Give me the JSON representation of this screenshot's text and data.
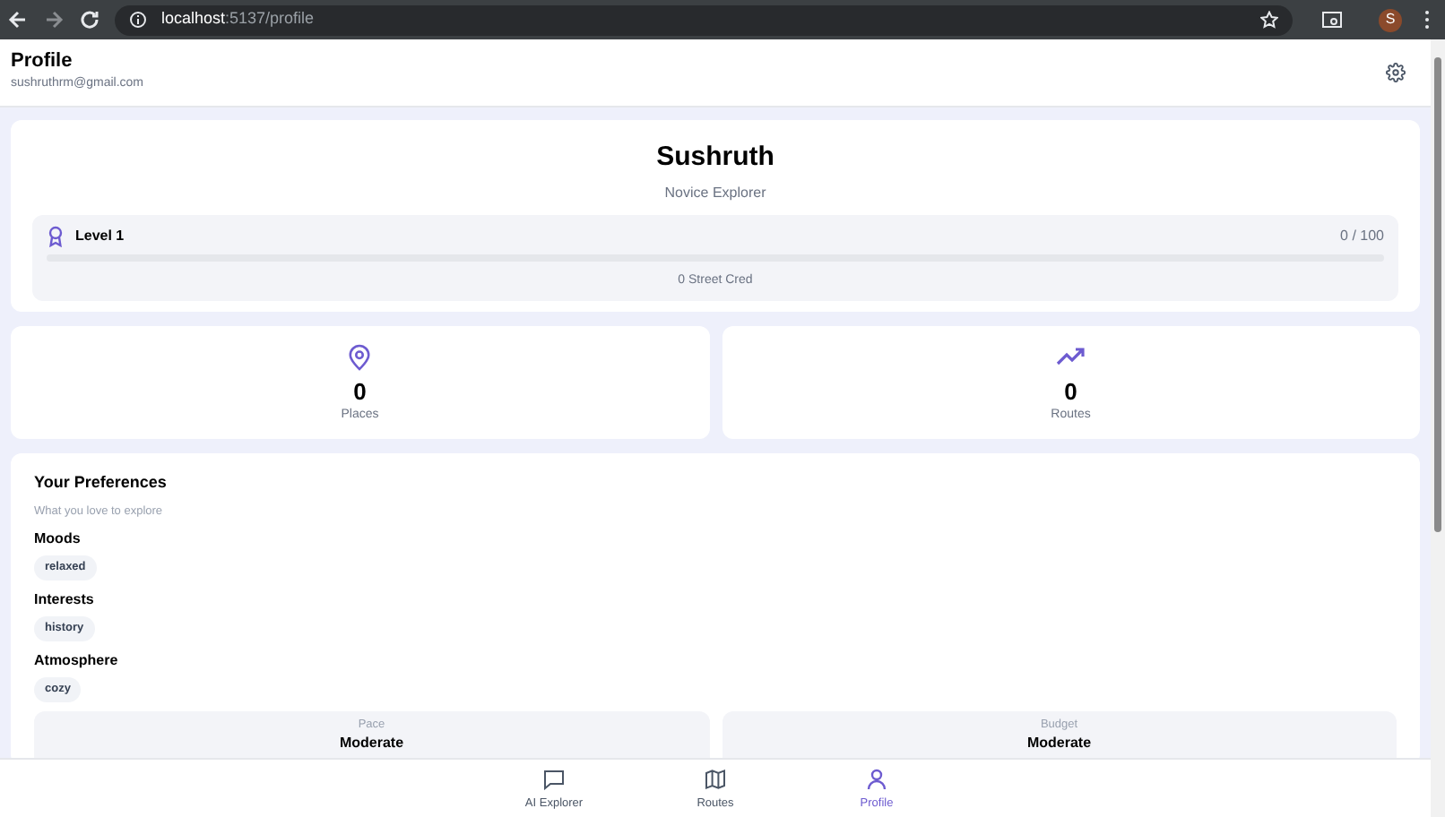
{
  "browser": {
    "url_host": "localhost",
    "url_rest": ":5137/profile",
    "avatar": "S"
  },
  "header": {
    "title": "Profile",
    "email": "sushruthrm@gmail.com"
  },
  "profile": {
    "name": "Sushruth",
    "rank": "Novice Explorer",
    "level_label": "Level 1",
    "progress_text": "0 / 100",
    "level": 0,
    "cred": "0 Street Cred"
  },
  "stats": [
    {
      "kind": "pin",
      "value": "0",
      "label": "Places"
    },
    {
      "kind": "trend",
      "value": "0",
      "label": "Routes"
    }
  ],
  "preferences": {
    "title": "Your Preferences",
    "subtitle": "What you love to explore",
    "groups": [
      {
        "title": "Moods",
        "tags": [
          "relaxed"
        ]
      },
      {
        "title": "Interests",
        "tags": [
          "history"
        ]
      },
      {
        "title": "Atmosphere",
        "tags": [
          "cozy"
        ]
      }
    ],
    "settings": [
      {
        "label": "Pace",
        "value": "Moderate"
      },
      {
        "label": "Budget",
        "value": "Moderate"
      }
    ]
  },
  "nav": [
    {
      "kind": "chat",
      "label": "AI Explorer",
      "selected": false
    },
    {
      "kind": "map",
      "label": "Routes",
      "selected": false
    },
    {
      "kind": "user",
      "label": "Profile",
      "selected": true
    }
  ]
}
